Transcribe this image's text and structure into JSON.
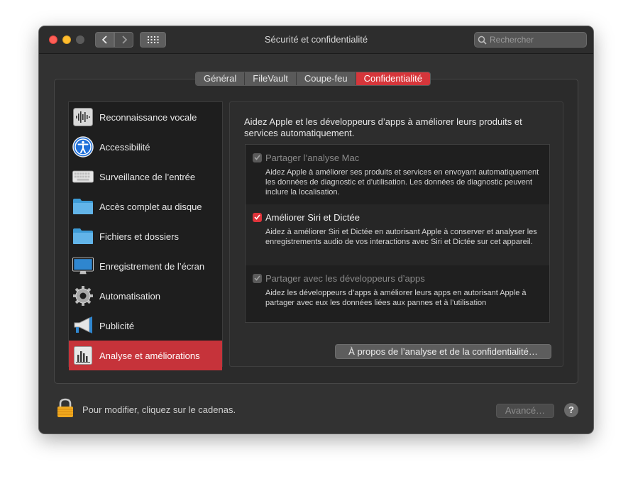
{
  "window": {
    "title": "Sécurité et confidentialité"
  },
  "search": {
    "placeholder": "Rechercher"
  },
  "tabs": [
    {
      "label": "Général"
    },
    {
      "label": "FileVault"
    },
    {
      "label": "Coupe-feu"
    },
    {
      "label": "Confidentialité",
      "active": true
    }
  ],
  "sidebar": {
    "items": [
      {
        "label": "Reconnaissance vocale",
        "icon": "waveform-icon"
      },
      {
        "label": "Accessibilité",
        "icon": "accessibility-icon"
      },
      {
        "label": "Surveillance de l’entrée",
        "icon": "keyboard-icon"
      },
      {
        "label": "Accès complet au disque",
        "icon": "folder-icon"
      },
      {
        "label": "Fichiers et dossiers",
        "icon": "folder-icon"
      },
      {
        "label": "Enregistrement de l’écran",
        "icon": "display-icon"
      },
      {
        "label": "Automatisation",
        "icon": "gear-icon"
      },
      {
        "label": "Publicité",
        "icon": "megaphone-icon"
      },
      {
        "label": "Analyse et améliorations",
        "icon": "bar-chart-icon",
        "selected": true
      }
    ]
  },
  "content": {
    "intro": "Aidez Apple et les développeurs d’apps à améliorer leurs produits et services automatiquement.",
    "options": [
      {
        "label": "Partager l’analyse Mac",
        "checked": true,
        "enabled": false,
        "description": "Aidez Apple à améliorer ses produits et services en envoyant automatiquement les données de diagnostic et d’utilisation. Les données de diagnostic peuvent inclure la localisation."
      },
      {
        "label": "Améliorer Siri et Dictée",
        "checked": true,
        "enabled": true,
        "description": "Aidez à améliorer Siri et Dictée en autorisant Apple à conserver et analyser les enregistrements audio de vos interactions avec Siri et Dictée sur cet appareil."
      },
      {
        "label": "Partager avec les développeurs d’apps",
        "checked": true,
        "enabled": false,
        "description": "Aidez les développeurs d’apps à améliorer leurs apps en autorisant Apple à partager avec eux les données liées aux pannes et à l’utilisation"
      }
    ],
    "about_button": "À propos de l’analyse et de la confidentialité…"
  },
  "footer": {
    "lock_text": "Pour modifier, cliquez sur le cadenas.",
    "advanced_button": "Avancé…",
    "help_label": "?"
  },
  "colors": {
    "accent": "#d6363b",
    "window_bg": "#323232",
    "sidebar_bg": "#1e1e1e"
  }
}
